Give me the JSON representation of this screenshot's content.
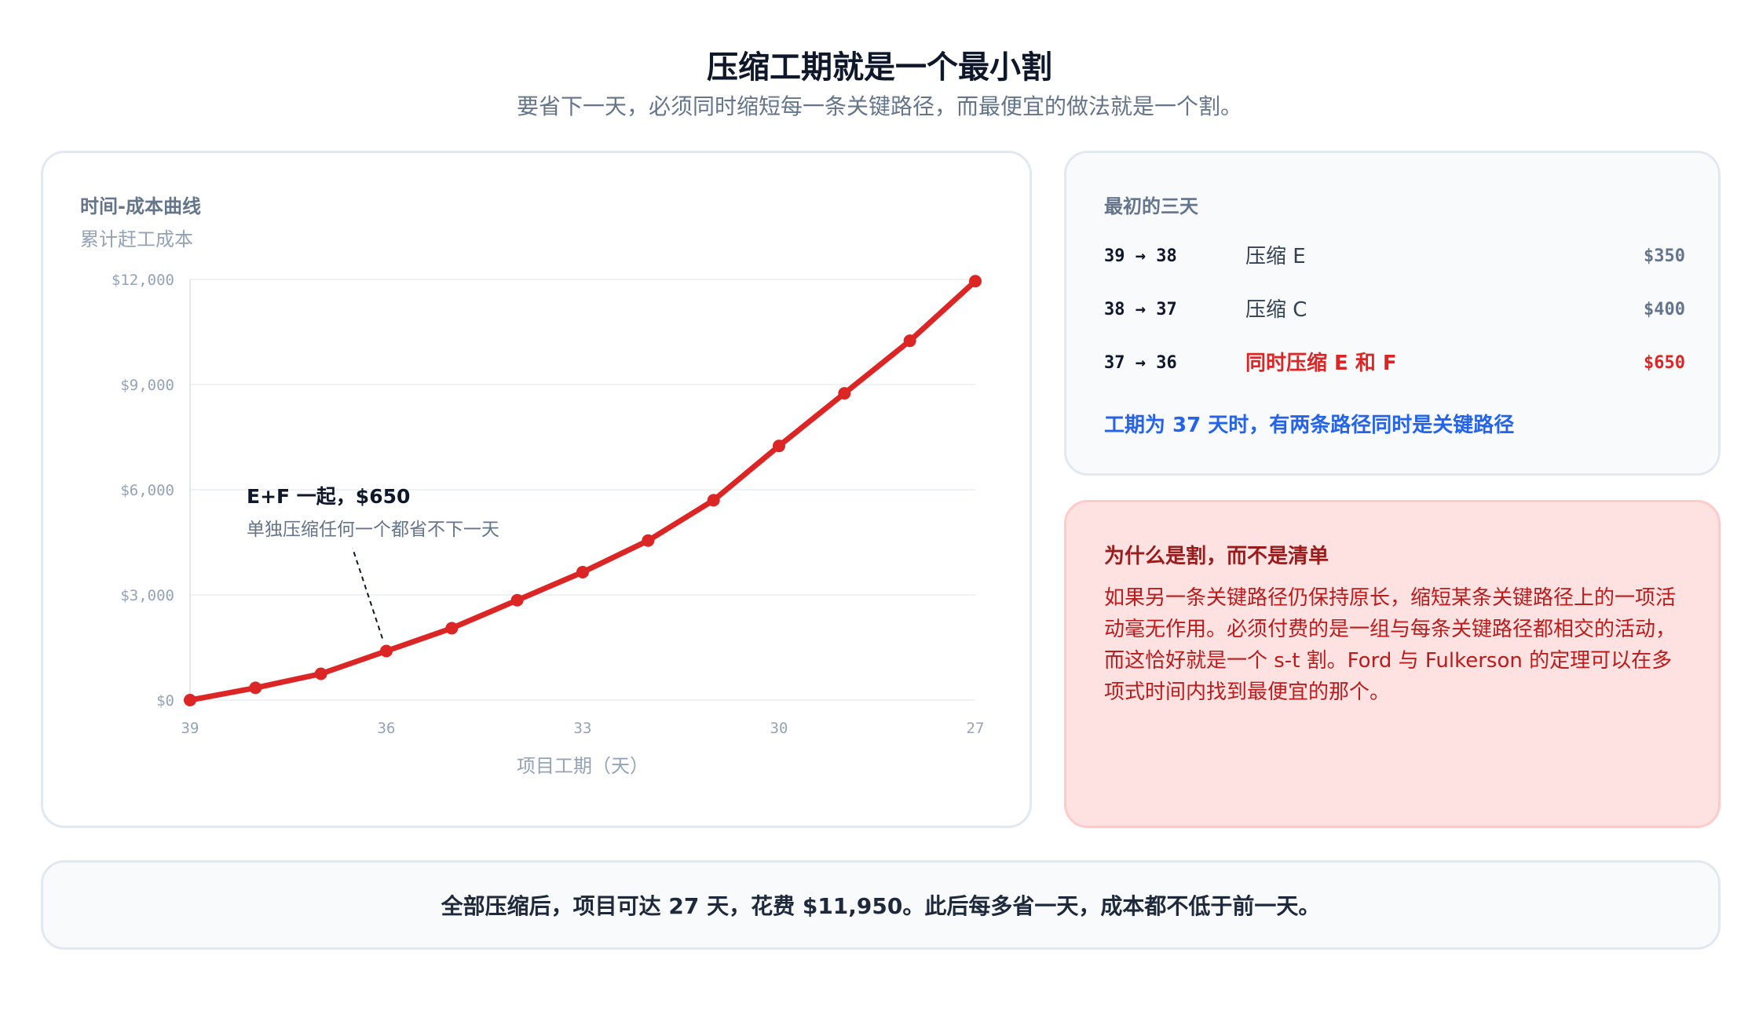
{
  "header": {
    "title": "压缩工期就是一个最小割",
    "subtitle": "要省下一天，必须同时缩短每一条关键路径，而最便宜的做法就是一个割。"
  },
  "chart_panel": {
    "heading": "时间-成本曲线",
    "subheading": "累计赶工成本"
  },
  "chart_data": {
    "type": "line",
    "x": [
      39,
      38,
      37,
      36,
      35,
      34,
      33,
      32,
      31,
      30,
      29,
      28,
      27
    ],
    "series": [
      {
        "values": [
          0,
          350,
          750,
          1400,
          2050,
          2850,
          3650,
          4550,
          5700,
          7250,
          8750,
          10250,
          11950
        ],
        "color": "#dc2626"
      }
    ],
    "xlabel": "项目工期（天）",
    "ylabel": "",
    "xlim": [
      39,
      27
    ],
    "ylim": [
      0,
      12000
    ],
    "x_ticks": [
      39,
      36,
      33,
      30,
      27
    ],
    "x_tick_labels": [
      "39",
      "36",
      "33",
      "30",
      "27"
    ],
    "y_ticks": [
      0,
      3000,
      6000,
      9000,
      12000
    ],
    "y_tick_labels": [
      "$0",
      "$3,000",
      "$6,000",
      "$9,000",
      "$12,000"
    ],
    "grid": true,
    "annotation": {
      "x": 36,
      "y": 1400,
      "title": "E+F 一起，$650",
      "text": "单独压缩任何一个都省不下一天"
    }
  },
  "first_days": {
    "heading": "最初的三天",
    "rows": [
      {
        "range": "39 → 38",
        "action": "压缩 E",
        "cost": "$350"
      },
      {
        "range": "38 → 37",
        "action": "压缩 C",
        "cost": "$400"
      },
      {
        "range": "37 → 36",
        "action": "同时压缩 E 和 F",
        "cost": "$650"
      }
    ],
    "note": "工期为 37 天时，有两条路径同时是关键路径"
  },
  "why_cut": {
    "heading": "为什么是割，而不是清单",
    "body": "如果另一条关键路径仍保持原长，缩短某条关键路径上的一项活动毫无作用。必须付费的是一组与每条关键路径都相交的活动，而这恰好就是一个 s-t 割。Ford 与 Fulkerson 的定理可以在多项式时间内找到最便宜的那个。"
  },
  "footer": {
    "text": "全部压缩后，项目可达 27 天，花费 $11,950。此后每多省一天，成本都不低于前一天。"
  },
  "colors": {
    "accent": "#dc2626",
    "note_blue": "#2563eb"
  }
}
